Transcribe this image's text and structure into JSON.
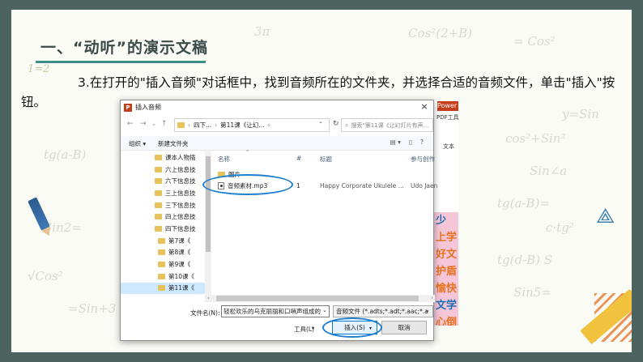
{
  "slide": {
    "title": "一、“动听”的演示文稿",
    "instruction": "3.在打开的\"插入音频\"对话框中，找到音频所在的文件夹，并选择合适的音频文件，单击\"插入\"按钮。",
    "chalk_math": [
      "1=2",
      "Cos²(2+B)",
      "= Cos²",
      "cos²+Sin²",
      "y=Sin",
      "Sin∠a",
      "tg(a-B)",
      "tg(a-B)=",
      "c·tg²",
      "tg(d-B) S",
      "Sin2=",
      "√Cos²",
      "=Sin+3",
      "Sin5=",
      "3π"
    ],
    "ppt_partial": {
      "ribbon_label": "Power",
      "pdf_label": "PDF工具",
      "text_label": "文本",
      "art_chars": [
        "少",
        "上学",
        "好文",
        "护盾",
        "愉快",
        "文学",
        "心倒"
      ]
    }
  },
  "dialog": {
    "title": "插入音频",
    "close_icon": "×",
    "address": {
      "crumbs": [
        "四下...",
        "第11课《让幻...",
        "›"
      ],
      "separator": "›",
      "dropdown": "⌄",
      "refresh": "↻"
    },
    "search_placeholder": "搜索\"第11课《让幻灯片有声...",
    "toolbar": {
      "organize": "组织 ▾",
      "new_folder": "新建文件夹",
      "view": "▤ ▾",
      "help": "?"
    },
    "nav_items": [
      {
        "label": "课本人物插",
        "selected": false,
        "sub": false
      },
      {
        "label": "六上信息技",
        "selected": false,
        "sub": false
      },
      {
        "label": "六下信息技",
        "selected": false,
        "sub": false
      },
      {
        "label": "三上信息技",
        "selected": false,
        "sub": false
      },
      {
        "label": "三下信息技",
        "selected": false,
        "sub": false
      },
      {
        "label": "四上信息技",
        "selected": false,
        "sub": false
      },
      {
        "label": "四下信息技",
        "selected": false,
        "sub": false
      },
      {
        "label": "第7课《",
        "selected": false,
        "sub": true
      },
      {
        "label": "第8课《",
        "selected": false,
        "sub": true
      },
      {
        "label": "第9课《",
        "selected": false,
        "sub": true
      },
      {
        "label": "第10课《",
        "selected": false,
        "sub": true
      },
      {
        "label": "第11课《",
        "selected": true,
        "sub": true
      }
    ],
    "columns": {
      "name": "名称",
      "number": "#",
      "title": "标题",
      "artist": "参与创作"
    },
    "files": [
      {
        "name": "图片",
        "type": "folder",
        "number": "",
        "title": "",
        "artist": ""
      },
      {
        "name": "音频素材.mp3",
        "type": "audio",
        "number": "1",
        "title": "Happy Corporate Ukulele ...",
        "artist": "Udo Jaen"
      }
    ],
    "filename_label": "文件名(N):",
    "filename_value": "轻松欢乐的乌克丽丽和口哨声组成的",
    "filetype_value": "音频文件 (*.adts;*.adt;*.aac;*.a",
    "tools_label": "工具(L)",
    "insert_label": "插入(S)",
    "cancel_label": "取消",
    "dropdown_glyph": "⌄",
    "accent_color": "#1d7fcf"
  }
}
